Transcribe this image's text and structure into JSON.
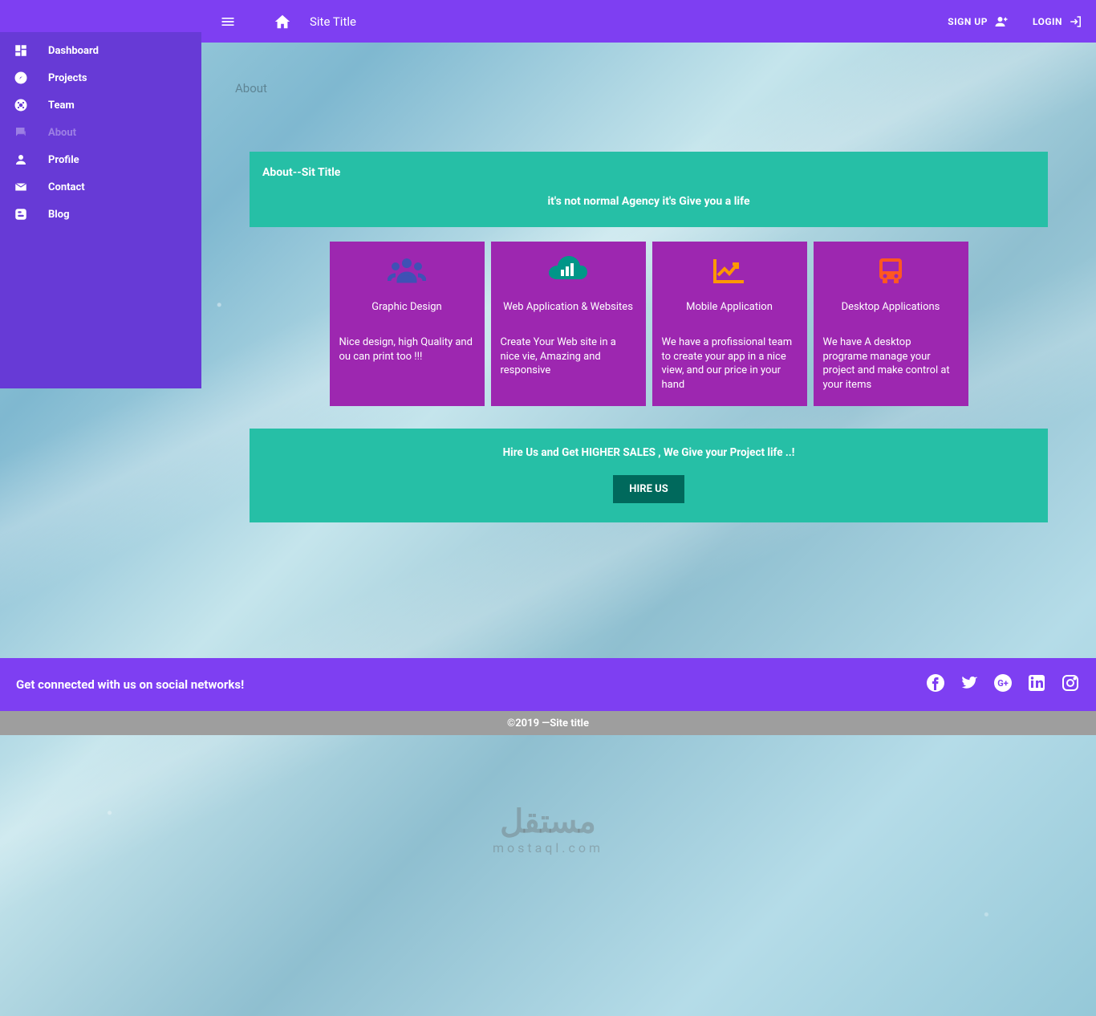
{
  "header": {
    "site_title": "Site Title",
    "signup": "SIGN UP",
    "login": "LOGIN"
  },
  "sidebar": {
    "items": [
      {
        "label": "Dashboard"
      },
      {
        "label": "Projects"
      },
      {
        "label": "Team"
      },
      {
        "label": "About"
      },
      {
        "label": "Profile"
      },
      {
        "label": "Contact"
      },
      {
        "label": "Blog"
      }
    ]
  },
  "breadcrumb": "About",
  "about": {
    "header_title": "About--Sit Title",
    "header_subtitle": "it's not normal Agency it's Give you a life",
    "cards": [
      {
        "title": "Graphic Design",
        "desc": "Nice design, high Quality and ou can print too !!!"
      },
      {
        "title": "Web Application & Websites",
        "desc": "Create Your Web site in a nice vie, Amazing and responsive"
      },
      {
        "title": "Mobile Application",
        "desc": "We have a profissional team to create your app in a nice view, and our price in your hand"
      },
      {
        "title": "Desktop Applications",
        "desc": "We have A desktop programe manage your project and make control at your items"
      }
    ],
    "hire_text": "Hire Us and Get HIGHER SALES , We Give your Project life ..!",
    "hire_button": "HIRE US"
  },
  "footer": {
    "social_text": "Get connected with us on social networks!",
    "copyright_prefix": "©2019 —",
    "copyright_site": "Site title"
  },
  "watermark": {
    "big": "مستقل",
    "small": "mostaql.com"
  }
}
